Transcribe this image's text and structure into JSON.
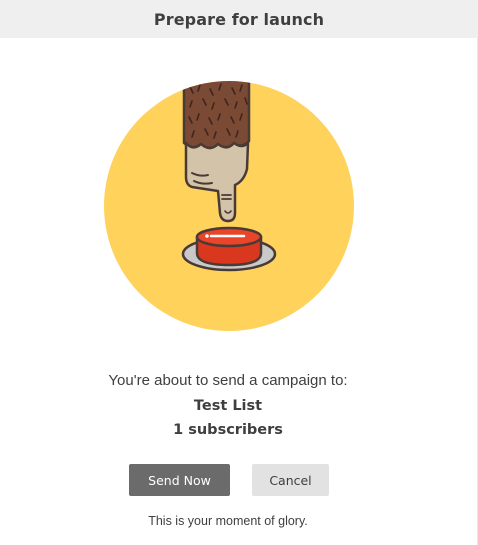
{
  "dialog": {
    "title": "Prepare for launch"
  },
  "illustration": {
    "icon": "finger-pressing-red-button-illustration",
    "circle_color": "#ffd25c",
    "button_color": "#d9381e"
  },
  "message": {
    "lead": "You're about to send a campaign to:",
    "list_name": "Test List",
    "subscriber_count": "1 subscribers"
  },
  "actions": {
    "send_now_label": "Send Now",
    "cancel_label": "Cancel"
  },
  "tagline": "This is your moment of glory.",
  "colors": {
    "header_bg": "#efefef",
    "primary_button": "#6b6b6b",
    "secondary_button": "#e2e2e2",
    "text": "#3f3f3f"
  }
}
